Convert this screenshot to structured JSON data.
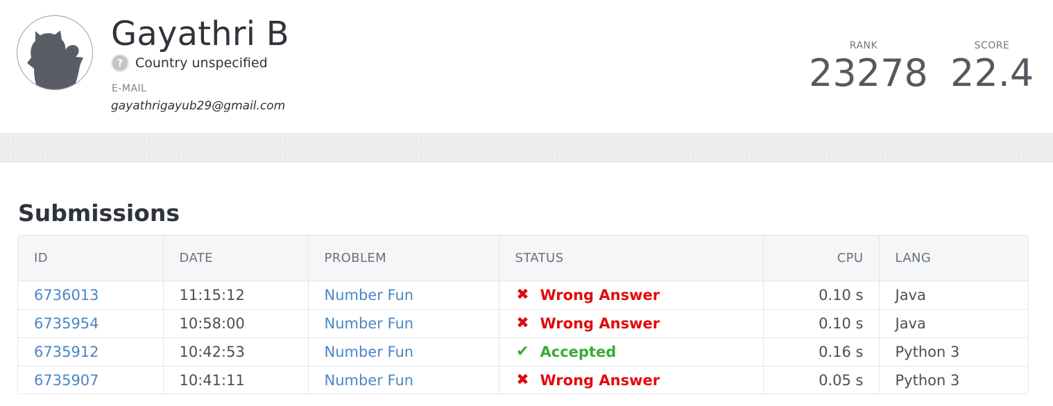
{
  "profile": {
    "name": "Gayathri B",
    "country": "Country unspecified",
    "email_label": "E-MAIL",
    "email": "gayathrigayub29@gmail.com",
    "avatar_icon": "cat-silhouette-avatar",
    "country_icon": "question-mark-icon"
  },
  "stats": {
    "rank_label": "RANK",
    "rank_value": "23278",
    "score_label": "SCORE",
    "score_value": "22.4"
  },
  "submissions": {
    "title": "Submissions",
    "columns": [
      "ID",
      "DATE",
      "PROBLEM",
      "STATUS",
      "CPU",
      "LANG"
    ],
    "rows": [
      {
        "id": "6736013",
        "date": "11:15:12",
        "problem": "Number Fun",
        "status": "Wrong Answer",
        "status_type": "wrong",
        "status_icon": "✖",
        "cpu": "0.10 s",
        "lang": "Java"
      },
      {
        "id": "6735954",
        "date": "10:58:00",
        "problem": "Number Fun",
        "status": "Wrong Answer",
        "status_type": "wrong",
        "status_icon": "✖",
        "cpu": "0.10 s",
        "lang": "Java"
      },
      {
        "id": "6735912",
        "date": "10:42:53",
        "problem": "Number Fun",
        "status": "Accepted",
        "status_type": "ok",
        "status_icon": "✔",
        "cpu": "0.16 s",
        "lang": "Python 3"
      },
      {
        "id": "6735907",
        "date": "10:41:11",
        "problem": "Number Fun",
        "status": "Wrong Answer",
        "status_type": "wrong",
        "status_icon": "✖",
        "cpu": "0.05 s",
        "lang": "Python 3"
      }
    ]
  },
  "colors": {
    "link": "#4a86c5",
    "wrong": "#e00c0c",
    "accepted": "#3aaa35"
  }
}
